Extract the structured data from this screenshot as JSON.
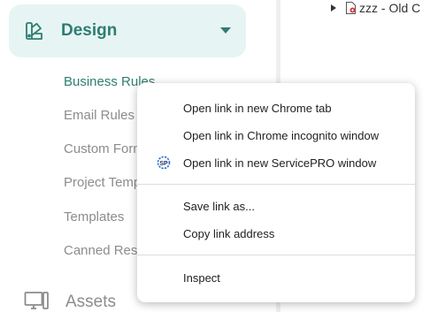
{
  "sidebar": {
    "design": {
      "label": "Design",
      "icon": "swatch-palette-icon",
      "chevron": "chevron-down-icon"
    },
    "items": [
      {
        "label": "Business Rules",
        "active": true
      },
      {
        "label": "Email Rules"
      },
      {
        "label": "Custom Forms"
      },
      {
        "label": "Project Templates"
      },
      {
        "label": "Templates"
      },
      {
        "label": "Canned Responses"
      }
    ],
    "assets": {
      "label": "Assets",
      "icon": "monitor-icon"
    }
  },
  "tree": {
    "row_label": "zzz - Old C",
    "expand_icon": "expand-arrow-icon",
    "file_icon": "shared-file-icon"
  },
  "context_menu": {
    "items": [
      {
        "label": "Open link in new Chrome tab"
      },
      {
        "label": "Open link in Chrome incognito window"
      },
      {
        "label": "Open link in new ServicePRO window",
        "icon": "servicepro-icon"
      },
      {
        "label": "Save link as..."
      },
      {
        "label": "Copy link address"
      },
      {
        "label": "Inspect"
      }
    ]
  },
  "colors": {
    "accent": "#2f7d73",
    "active_bg": "#e6f5f3",
    "muted_text": "#8c8c8c",
    "servicepro_blue": "#1d6fd6"
  }
}
